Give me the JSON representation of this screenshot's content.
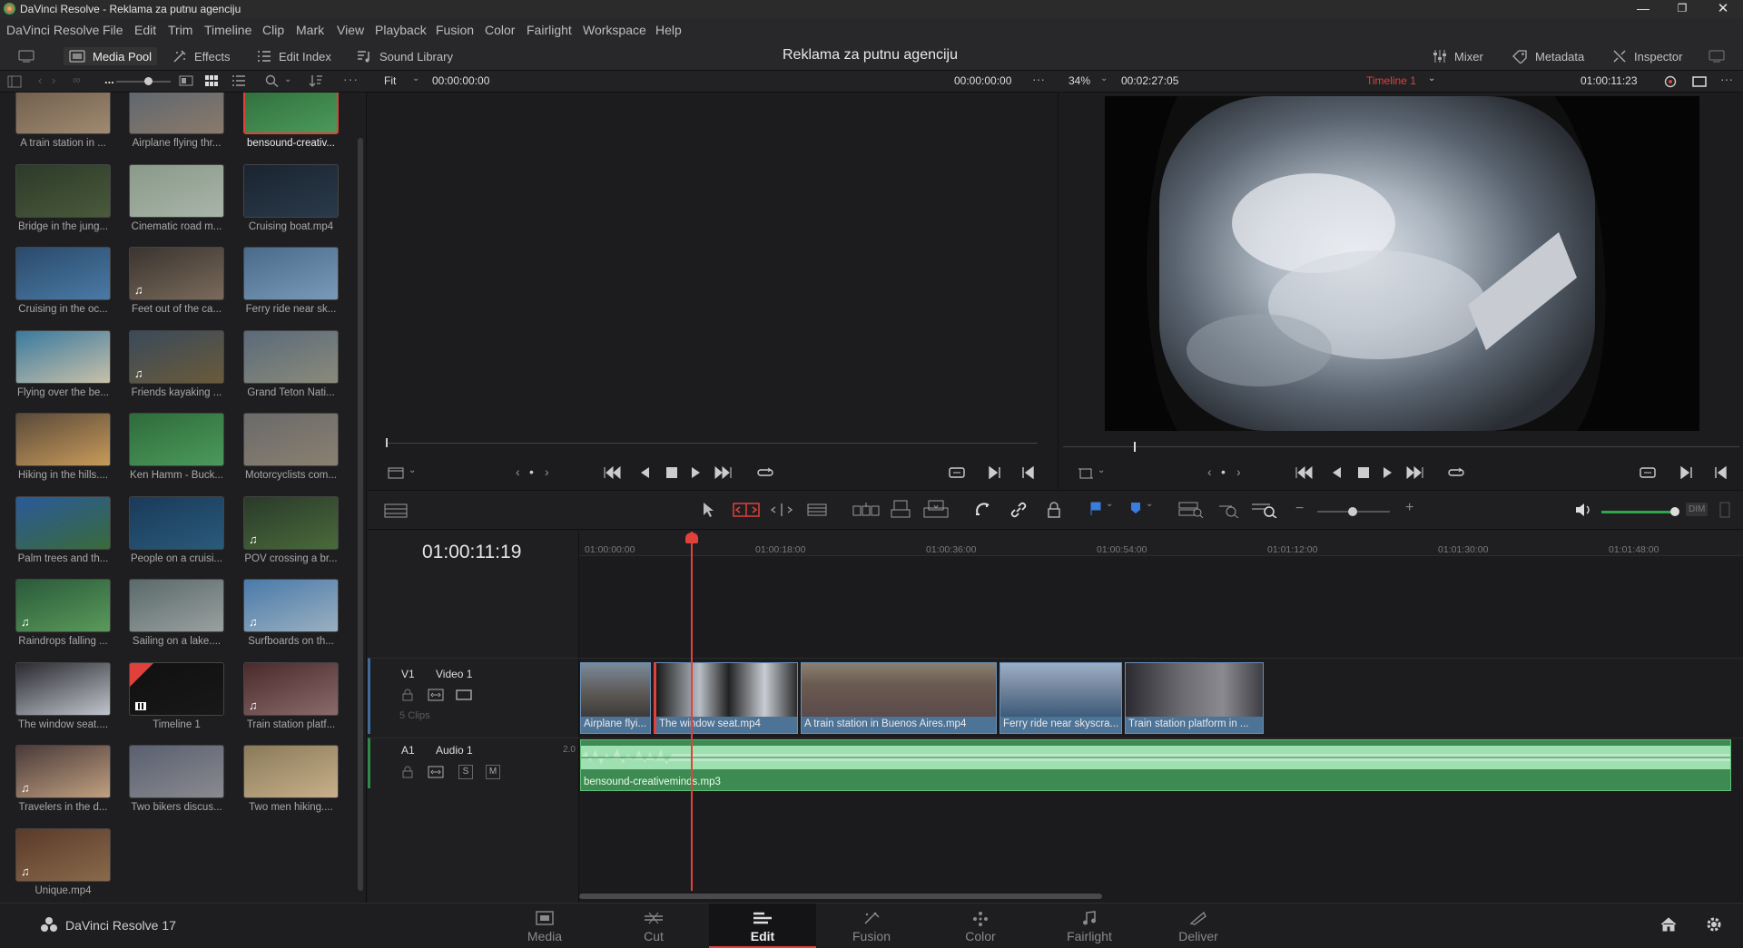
{
  "window": {
    "title": "DaVinci Resolve - Reklama za putnu agenciju"
  },
  "menu": [
    "DaVinci Resolve",
    "File",
    "Edit",
    "Trim",
    "Timeline",
    "Clip",
    "Mark",
    "View",
    "Playback",
    "Fusion",
    "Color",
    "Fairlight",
    "Workspace",
    "Help"
  ],
  "toolbar": {
    "media_pool": "Media Pool",
    "effects": "Effects",
    "edit_index": "Edit Index",
    "sound_library": "Sound Library",
    "project_title": "Reklama za putnu agenciju",
    "mixer": "Mixer",
    "metadata": "Metadata",
    "inspector": "Inspector"
  },
  "subbar": {
    "dots": "...",
    "fit": "Fit",
    "src_tc_left": "00:00:00:00",
    "src_tc_right": "00:00:00:00",
    "zoom": "34%",
    "duration": "00:02:27:05",
    "timeline_name": "Timeline 1",
    "prog_tc": "01:00:11:23"
  },
  "media_pool": [
    {
      "label": "A train station in ...",
      "icon": "",
      "colors": [
        "#6b5a4a",
        "#a08a70"
      ]
    },
    {
      "label": "Airplane flying thr...",
      "icon": "",
      "colors": [
        "#5a6470",
        "#8a7a6a"
      ]
    },
    {
      "label": "bensound-creativ...",
      "icon": "",
      "colors": [
        "#2f6b3c",
        "#4b9a5a"
      ],
      "selected": true
    },
    {
      "label": "Bridge in the jung...",
      "icon": "",
      "colors": [
        "#2c3a2a",
        "#4a5a3a"
      ]
    },
    {
      "label": "Cinematic road m...",
      "icon": "",
      "colors": [
        "#8a9a8a",
        "#a8b4a8"
      ]
    },
    {
      "label": "Cruising boat.mp4",
      "icon": "",
      "colors": [
        "#1a2430",
        "#2a3a4a"
      ]
    },
    {
      "label": "Cruising in the oc...",
      "icon": "",
      "colors": [
        "#2a4a6a",
        "#4a7aa6"
      ]
    },
    {
      "label": "Feet out of the ca...",
      "icon": "music-note",
      "colors": [
        "#3a3430",
        "#7a6a5a"
      ]
    },
    {
      "label": "Ferry ride near sk...",
      "icon": "",
      "colors": [
        "#4a6a8a",
        "#7a9aba"
      ]
    },
    {
      "label": "Flying over the be...",
      "icon": "",
      "colors": [
        "#3a7aa0",
        "#c8c0a8"
      ]
    },
    {
      "label": "Friends kayaking ...",
      "icon": "music-note",
      "colors": [
        "#3a4a5a",
        "#6a5a3a"
      ]
    },
    {
      "label": "Grand Teton Nati...",
      "icon": "",
      "colors": [
        "#5a6a7a",
        "#8a8a7a"
      ]
    },
    {
      "label": "Hiking in the hills....",
      "icon": "",
      "colors": [
        "#5a4a3a",
        "#c89a5a"
      ]
    },
    {
      "label": "Ken Hamm - Buck...",
      "icon": "",
      "colors": [
        "#2f6b3c",
        "#4b9a5a"
      ]
    },
    {
      "label": "Motorcyclists com...",
      "icon": "",
      "colors": [
        "#6a6a6a",
        "#8a8070"
      ]
    },
    {
      "label": "Palm trees and th...",
      "icon": "",
      "colors": [
        "#2a5a9a",
        "#3a6a3a"
      ]
    },
    {
      "label": "People on a cruisi...",
      "icon": "",
      "colors": [
        "#1a3a5a",
        "#2a5a7a"
      ]
    },
    {
      "label": "POV crossing a br...",
      "icon": "music-note",
      "colors": [
        "#2a3a2a",
        "#4a6a3a"
      ]
    },
    {
      "label": "Raindrops falling ...",
      "icon": "music-note",
      "colors": [
        "#2a5a3a",
        "#5a9a5a"
      ]
    },
    {
      "label": "Sailing on a lake....",
      "icon": "",
      "colors": [
        "#5a6a6a",
        "#9aa0a0"
      ]
    },
    {
      "label": "Surfboards on th...",
      "icon": "music-note",
      "colors": [
        "#4a7aaa",
        "#9ab0c0"
      ]
    },
    {
      "label": "The window seat....",
      "icon": "",
      "colors": [
        "#2a2a30",
        "#c0c4cc"
      ]
    },
    {
      "label": "Timeline 1",
      "icon": "timeline-grid",
      "colors": [
        "#101010",
        "#181818"
      ]
    },
    {
      "label": "Train station platf...",
      "icon": "music-note",
      "colors": [
        "#4a2a2a",
        "#8a6a6a"
      ]
    },
    {
      "label": "Travelers in the d...",
      "icon": "music-note",
      "colors": [
        "#4a3a3a",
        "#c0a080"
      ]
    },
    {
      "label": "Two bikers discus...",
      "icon": "",
      "colors": [
        "#5a6070",
        "#8a8a90"
      ]
    },
    {
      "label": "Two men hiking....",
      "icon": "",
      "colors": [
        "#8a7a5a",
        "#c8b08a"
      ]
    },
    {
      "label": "Unique.mp4",
      "icon": "music-note",
      "colors": [
        "#5a3a2a",
        "#8a6a4a"
      ]
    }
  ],
  "timeline": {
    "timecode": "01:00:11:19",
    "ruler": [
      "01:00:00:00",
      "01:00:18:00",
      "01:00:36:00",
      "01:00:54:00",
      "01:01:12:00",
      "01:01:30:00",
      "01:01:48:00"
    ],
    "v1": {
      "id": "V1",
      "name": "Video 1",
      "clip_count": "5 Clips"
    },
    "a1": {
      "id": "A1",
      "name": "Audio 1",
      "level": "2.0",
      "s": "S",
      "m": "M"
    },
    "clips": [
      "Airplane flyi...",
      "The window seat.mp4",
      "A train station in Buenos Aires.mp4",
      "Ferry ride near skyscra...",
      "Train station platform in ..."
    ],
    "audio_clip": "bensound-creativeminds.mp3",
    "dim": "DIM"
  },
  "pages": [
    "Media",
    "Cut",
    "Edit",
    "Fusion",
    "Color",
    "Fairlight",
    "Deliver"
  ],
  "active_page": "Edit",
  "app_name": "DaVinci Resolve 17",
  "colors": {
    "accent_red": "#e0413b",
    "clip_blue": "#4d7397",
    "audio_green": "#3d8b53"
  }
}
